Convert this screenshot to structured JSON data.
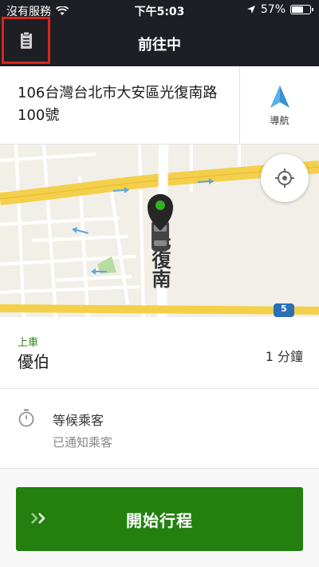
{
  "status_bar": {
    "carrier": "沒有服務",
    "time": "下午5:03",
    "battery": "57%",
    "battery_level": 0.57
  },
  "header": {
    "title": "前往中",
    "icons": [
      "clipboard-icon"
    ]
  },
  "address": {
    "text": "106台灣台北市大安區光復南路100號",
    "navigate_label": "導航"
  },
  "map": {
    "street_label": "光復南",
    "route_marker": "5"
  },
  "pickup": {
    "tag": "上車",
    "rider_name": "優伯",
    "eta": "1 分鐘"
  },
  "waiting": {
    "title": "等候乘客",
    "subtitle": "已通知乘客"
  },
  "action": {
    "start_label": "開始行程"
  },
  "colors": {
    "header_bg": "#1e1f24",
    "accent_green": "#23800f",
    "tag_green": "#2d8a17",
    "highlight_red": "#d9251c",
    "nav_blue": "#3a8fd0"
  }
}
